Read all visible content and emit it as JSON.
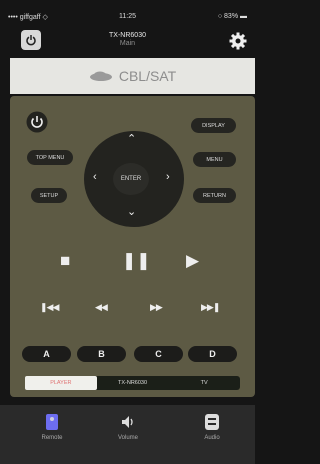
{
  "status": {
    "carrier": "•••• giffgaff ◇",
    "time": "11:25",
    "battery": "○ 83% ▬"
  },
  "header": {
    "device": "TX-NR6030",
    "subtitle": "Main"
  },
  "source": {
    "label": "CBL/SAT"
  },
  "remote": {
    "top_menu": "TOP MENU",
    "display": "DISPLAY",
    "menu": "MENU",
    "setup": "SETUP",
    "return": "RETURN",
    "enter": "ENTER",
    "colors": [
      "A",
      "B",
      "C",
      "D"
    ]
  },
  "tabs": [
    "PLAYER",
    "TX-NR6030",
    "TV"
  ],
  "bottom_nav": [
    "Remote",
    "Volume",
    "Audio"
  ],
  "colors": {
    "panel": "#5d5a44",
    "source_bar": "#e6e6e2",
    "active_tab_text": "#e07474",
    "bottom": "#2a2a2a"
  }
}
